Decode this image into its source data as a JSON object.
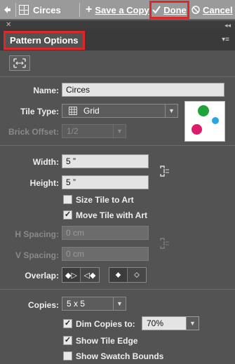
{
  "topbar": {
    "back_icon": "arrow-left-icon",
    "pattern_name": "Circes",
    "save_copy": "Save a Copy",
    "done": "Done",
    "cancel": "Cancel",
    "done_highlight_color": "#e02727"
  },
  "panel": {
    "tab_title": "Pattern Options",
    "tab_highlight_color": "#e02727",
    "menu_icon": "panel-menu-icon",
    "tool_icon": "pattern-tile-tool-icon"
  },
  "form": {
    "name_label": "Name:",
    "name_value": "Circes",
    "tile_type_label": "Tile Type:",
    "tile_type_value": "Grid",
    "brick_offset_label": "Brick Offset:",
    "brick_offset_value": "1/2",
    "width_label": "Width:",
    "width_value": "5 ”",
    "height_label": "Height:",
    "height_value": "5 ”",
    "size_tile_to_art": "Size Tile to Art",
    "move_tile_with_art": "Move Tile with Art",
    "h_spacing_label": "H Spacing:",
    "h_spacing_value": "0 cm",
    "v_spacing_label": "V Spacing:",
    "v_spacing_value": "0 cm",
    "overlap_label": "Overlap:",
    "copies_label": "Copies:",
    "copies_value": "5 x 5",
    "dim_copies_to": "Dim Copies to:",
    "dim_copies_value": "70%",
    "show_tile_edge": "Show Tile Edge",
    "show_swatch_bounds": "Show Swatch Bounds"
  },
  "checks": {
    "size_tile_to_art": false,
    "move_tile_with_art": true,
    "dim_copies_to": true,
    "show_tile_edge": true,
    "show_swatch_bounds": false
  },
  "preview_colors": {
    "green": "#1fa33a",
    "blue": "#27a6e0",
    "pink": "#de1a6a"
  }
}
